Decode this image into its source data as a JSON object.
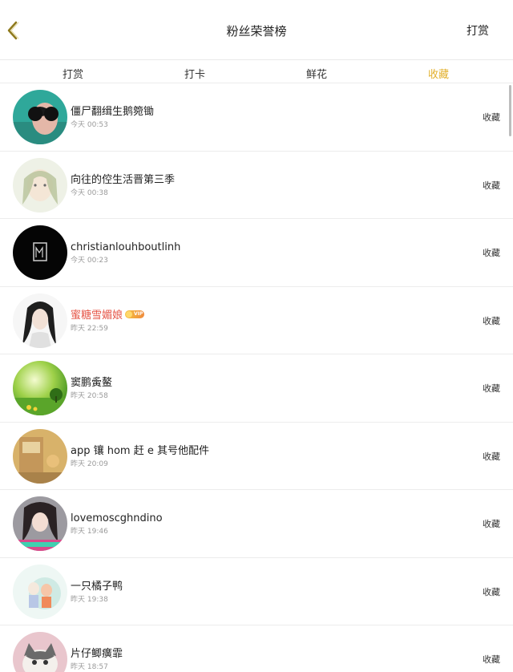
{
  "nav": {
    "title": "粉丝荣誉榜",
    "action": "打赏",
    "back_icon": "chevron-left-icon",
    "back_color": "#8f7a1d"
  },
  "tabs": [
    {
      "label": "打赏",
      "active": false
    },
    {
      "label": "打卡",
      "active": false
    },
    {
      "label": "鲜花",
      "active": false
    },
    {
      "label": "收藏",
      "active": true
    }
  ],
  "accent_color": "#e2b02d",
  "rows": [
    {
      "name": "僵尸翻缉生鹅箢锄",
      "time": "今天 00:53",
      "action": "收藏",
      "vip": false
    },
    {
      "name": "向往的倥生活晋第三季",
      "time": "今天 00:38",
      "action": "收藏",
      "vip": false
    },
    {
      "name": "christianlouhboutlinh",
      "time": "今天 00:23",
      "action": "收藏",
      "vip": false
    },
    {
      "name": "蜜糖雪媚娘",
      "time": "昨天 22:59",
      "action": "收藏",
      "vip": true,
      "badge": "VIP"
    },
    {
      "name": "窦鹏夤鳌",
      "time": "昨天 20:58",
      "action": "收藏",
      "vip": false
    },
    {
      "name": "app 镶 hom 赶 e 其号他配件",
      "time": "昨天 20:09",
      "action": "收藏",
      "vip": false
    },
    {
      "name": "lovemoscghndino",
      "time": "昨天 19:46",
      "action": "收藏",
      "vip": false
    },
    {
      "name": "一只橘子鸭",
      "time": "昨天 19:38",
      "action": "收藏",
      "vip": false
    },
    {
      "name": "片仔鲫癀霏",
      "time": "昨天 18:57",
      "action": "收藏",
      "vip": false
    }
  ]
}
